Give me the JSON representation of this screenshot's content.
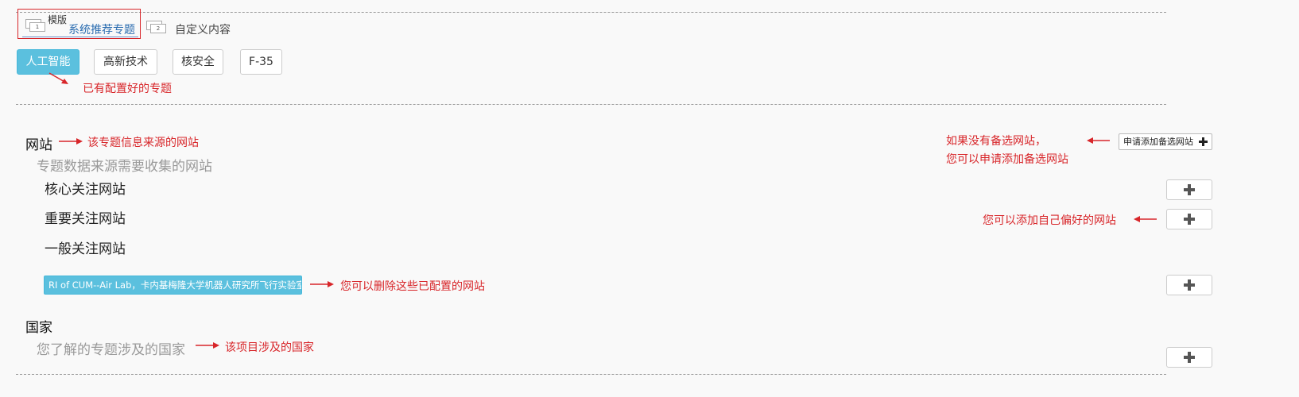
{
  "template": {
    "label": "模版",
    "tabs": [
      {
        "label": "系统推荐专题",
        "num": "1"
      },
      {
        "label": "自定义内容",
        "num": "2"
      }
    ]
  },
  "topics": [
    "人工智能",
    "高新技术",
    "核安全",
    "F-35"
  ],
  "annotations": {
    "configured_topic": "已有配置好的专题",
    "source_sites": "该专题信息来源的网站",
    "no_backup_line1": "如果没有备选网站，",
    "no_backup_line2": "您可以申请添加备选网站",
    "add_preferred": "您可以添加自己偏好的网站",
    "delete_configured": "您可以删除这些已配置的网站",
    "project_countries": "该项目涉及的国家"
  },
  "website_section": {
    "title": "网站",
    "subtitle": "专题数据来源需要收集的网站",
    "apply_button": "申请添加备选网站",
    "categories": [
      "核心关注网站",
      "重要关注网站",
      "一般关注网站"
    ],
    "configured_sites": [
      "RI of CUM--Air Lab，卡内基梅隆大学机器人研究所飞行实验室"
    ]
  },
  "country_section": {
    "title": "国家",
    "subtitle": "您了解的专题涉及的国家"
  },
  "colors": {
    "accent": "#5bc0de",
    "annotation_red": "#d8262a",
    "tab_link": "#2a6cb0"
  }
}
